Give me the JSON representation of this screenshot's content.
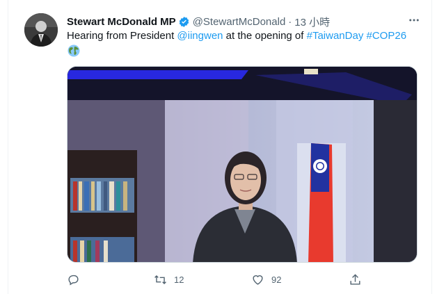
{
  "tweet": {
    "author_name": "Stewart McDonald MP",
    "handle": "@StewartMcDonald",
    "separator": "·",
    "time": "13 小時",
    "text_prefix": "Hearing from President ",
    "mention": "@iingwen",
    "text_middle": " at the opening of ",
    "hashtag1": "#TaiwanDay",
    "hashtag2": "#COP26",
    "more_icon": "more-dots-icon",
    "emoji": "earth-globe-emoji"
  },
  "actions": {
    "reply_count": "",
    "retweet_count": "12",
    "like_count": "92"
  },
  "colors": {
    "accent": "#1d9bf0",
    "secondary_text": "#536471",
    "primary_text": "#0f1419",
    "verified_badge": "#1d9bf0"
  }
}
